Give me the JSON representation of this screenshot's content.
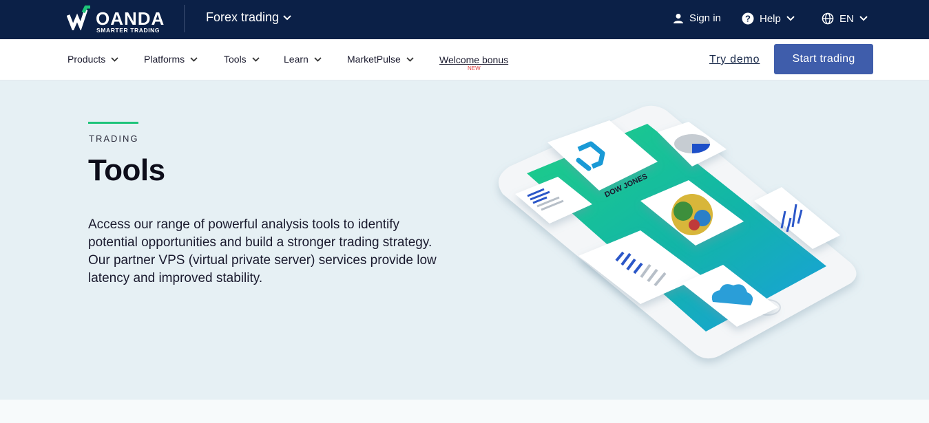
{
  "topbar": {
    "logo_word": "OANDA",
    "logo_sub": "SMARTER TRADING",
    "site_switch": "Forex trading",
    "sign_in": "Sign in",
    "help": "Help",
    "language": "EN"
  },
  "nav": {
    "items": [
      "Products",
      "Platforms",
      "Tools",
      "Learn",
      "MarketPulse"
    ],
    "bonus": "Welcome bonus",
    "bonus_badge": "NEW",
    "try_demo": "Try demo",
    "start_trading": "Start trading"
  },
  "hero": {
    "eyebrow": "TRADING",
    "title": "Tools",
    "description": "Access our range of powerful analysis tools to identify potential opportunities and build a stronger trading strategy. Our partner VPS (virtual private server) services provide low latency and improved stability.",
    "illustration_label": "DOW JONES"
  },
  "colors": {
    "topbar": "#0b2047",
    "accent": "#1ec47a",
    "button": "#3f5dab",
    "hero_bg": "#e6f0f4"
  },
  "icons": [
    "oanda-logo-icon",
    "chevron-down-icon",
    "user-icon",
    "help-circle-icon",
    "globe-icon"
  ]
}
